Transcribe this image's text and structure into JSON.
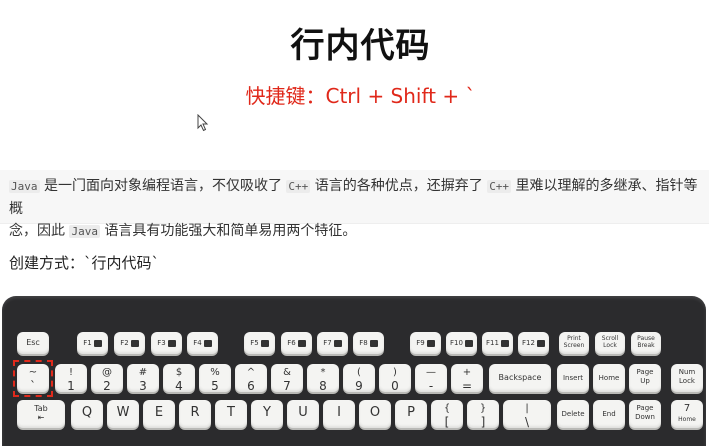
{
  "heading": {
    "title": "行内代码",
    "shortcut": "快捷键：Ctrl + Shift + `"
  },
  "quote": {
    "code_java": "Java",
    "text_1": "是一门面向对象编程语言，不仅吸收了",
    "code_cpp_1": "C++",
    "text_2": "语言的各种优点，还摒弃了",
    "code_cpp_2": "C++",
    "text_3": "里难以理解的多继承、指针等概",
    "text_4": "念，因此",
    "code_java_2": "Java",
    "text_5": "语言具有功能强大和简单易用两个特征。"
  },
  "method": {
    "label": "创建方式：`行内代码`"
  },
  "keyboard": {
    "esc": "Esc",
    "fkeys": [
      "F1",
      "F2",
      "F3",
      "F4",
      "F5",
      "F6",
      "F7",
      "F8",
      "F9",
      "F10",
      "F11",
      "F12"
    ],
    "print_screen": [
      "Print",
      "Screen"
    ],
    "scroll_lock": [
      "Scroll",
      "Lock"
    ],
    "pause_break": [
      "Pause",
      "Break"
    ],
    "number_row": [
      {
        "top": "~",
        "bot": "`"
      },
      {
        "top": "!",
        "bot": "1"
      },
      {
        "top": "@",
        "bot": "2"
      },
      {
        "top": "#",
        "bot": "3"
      },
      {
        "top": "$",
        "bot": "4"
      },
      {
        "top": "%",
        "bot": "5"
      },
      {
        "top": "^",
        "bot": "6"
      },
      {
        "top": "&",
        "bot": "7"
      },
      {
        "top": "*",
        "bot": "8"
      },
      {
        "top": "(",
        "bot": "9"
      },
      {
        "top": ")",
        "bot": "0"
      },
      {
        "top": "—",
        "bot": "-"
      },
      {
        "top": "+",
        "bot": "="
      }
    ],
    "backspace": "Backspace",
    "insert": "Insert",
    "home": "Home",
    "page_up": [
      "Page",
      "Up"
    ],
    "num_lock": [
      "Num",
      "Lock"
    ],
    "tab": "Tab",
    "letters": [
      "Q",
      "W",
      "E",
      "R",
      "T",
      "Y",
      "U",
      "I",
      "O",
      "P"
    ],
    "brackets": [
      {
        "top": "{",
        "bot": "["
      },
      {
        "top": "}",
        "bot": "]"
      },
      {
        "top": "|",
        "bot": "\\"
      }
    ],
    "delete": "Delete",
    "end": "End",
    "page_down": [
      "Page",
      "Down"
    ],
    "num7": {
      "top": "7",
      "bot": "Home"
    }
  },
  "colors": {
    "accent_red": "#e0281a",
    "keyboard_body": "#2b2b2d",
    "keycap": "#f4f4f2"
  }
}
